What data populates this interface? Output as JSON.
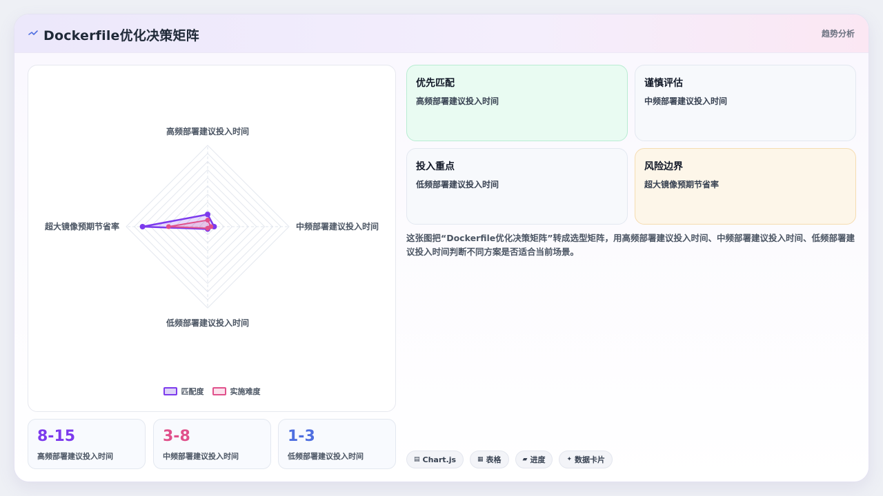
{
  "header": {
    "title": "Dockerfile优化决策矩阵",
    "right_label": "趋势分析"
  },
  "chart_data": {
    "type": "radar",
    "axes": [
      "高频部署建议投入时间",
      "中频部署建议投入时间",
      "低频部署建议投入时间",
      "超大镜像预期节省率"
    ],
    "series": [
      {
        "name": "匹配度",
        "values": [
          15,
          8,
          3,
          80
        ],
        "color": "#7c3aed"
      },
      {
        "name": "实施难度",
        "values": [
          8,
          4,
          2,
          48
        ],
        "color": "#e0508b"
      }
    ],
    "max": 100,
    "grid_levels": 10
  },
  "stats": [
    {
      "value": "8-15",
      "label": "高频部署建议投入时间",
      "color": "#7c3aed"
    },
    {
      "value": "3-8",
      "label": "中频部署建议投入时间",
      "color": "#e0508b"
    },
    {
      "value": "1-3",
      "label": "低频部署建议投入时间",
      "color": "#4f6fe0"
    }
  ],
  "quadrants": [
    {
      "title": "优先匹配",
      "desc": "高频部署建议投入时间",
      "bg": "#e9fbf2",
      "border": "#b8ecd2"
    },
    {
      "title": "谨慎评估",
      "desc": "中频部署建议投入时间",
      "bg": "#f7f9fc",
      "border": "#e3e8f0"
    },
    {
      "title": "投入重点",
      "desc": "低频部署建议投入时间",
      "bg": "#f7f9fc",
      "border": "#e3e8f0"
    },
    {
      "title": "风险边界",
      "desc": "超大镜像预期节省率",
      "bg": "#fdf6e9",
      "border": "#f5dcb0"
    }
  ],
  "description": "这张图把“Dockerfile优化决策矩阵”转成选型矩阵，用高频部署建议投入时间、中频部署建议投入时间、低频部署建议投入时间判断不同方案是否适合当前场景。",
  "tags": [
    {
      "icon": "▤",
      "label": "Chart.js"
    },
    {
      "icon": "▦",
      "label": "表格"
    },
    {
      "icon": "▰",
      "label": "进度"
    },
    {
      "icon": "✦",
      "label": "数据卡片"
    }
  ]
}
